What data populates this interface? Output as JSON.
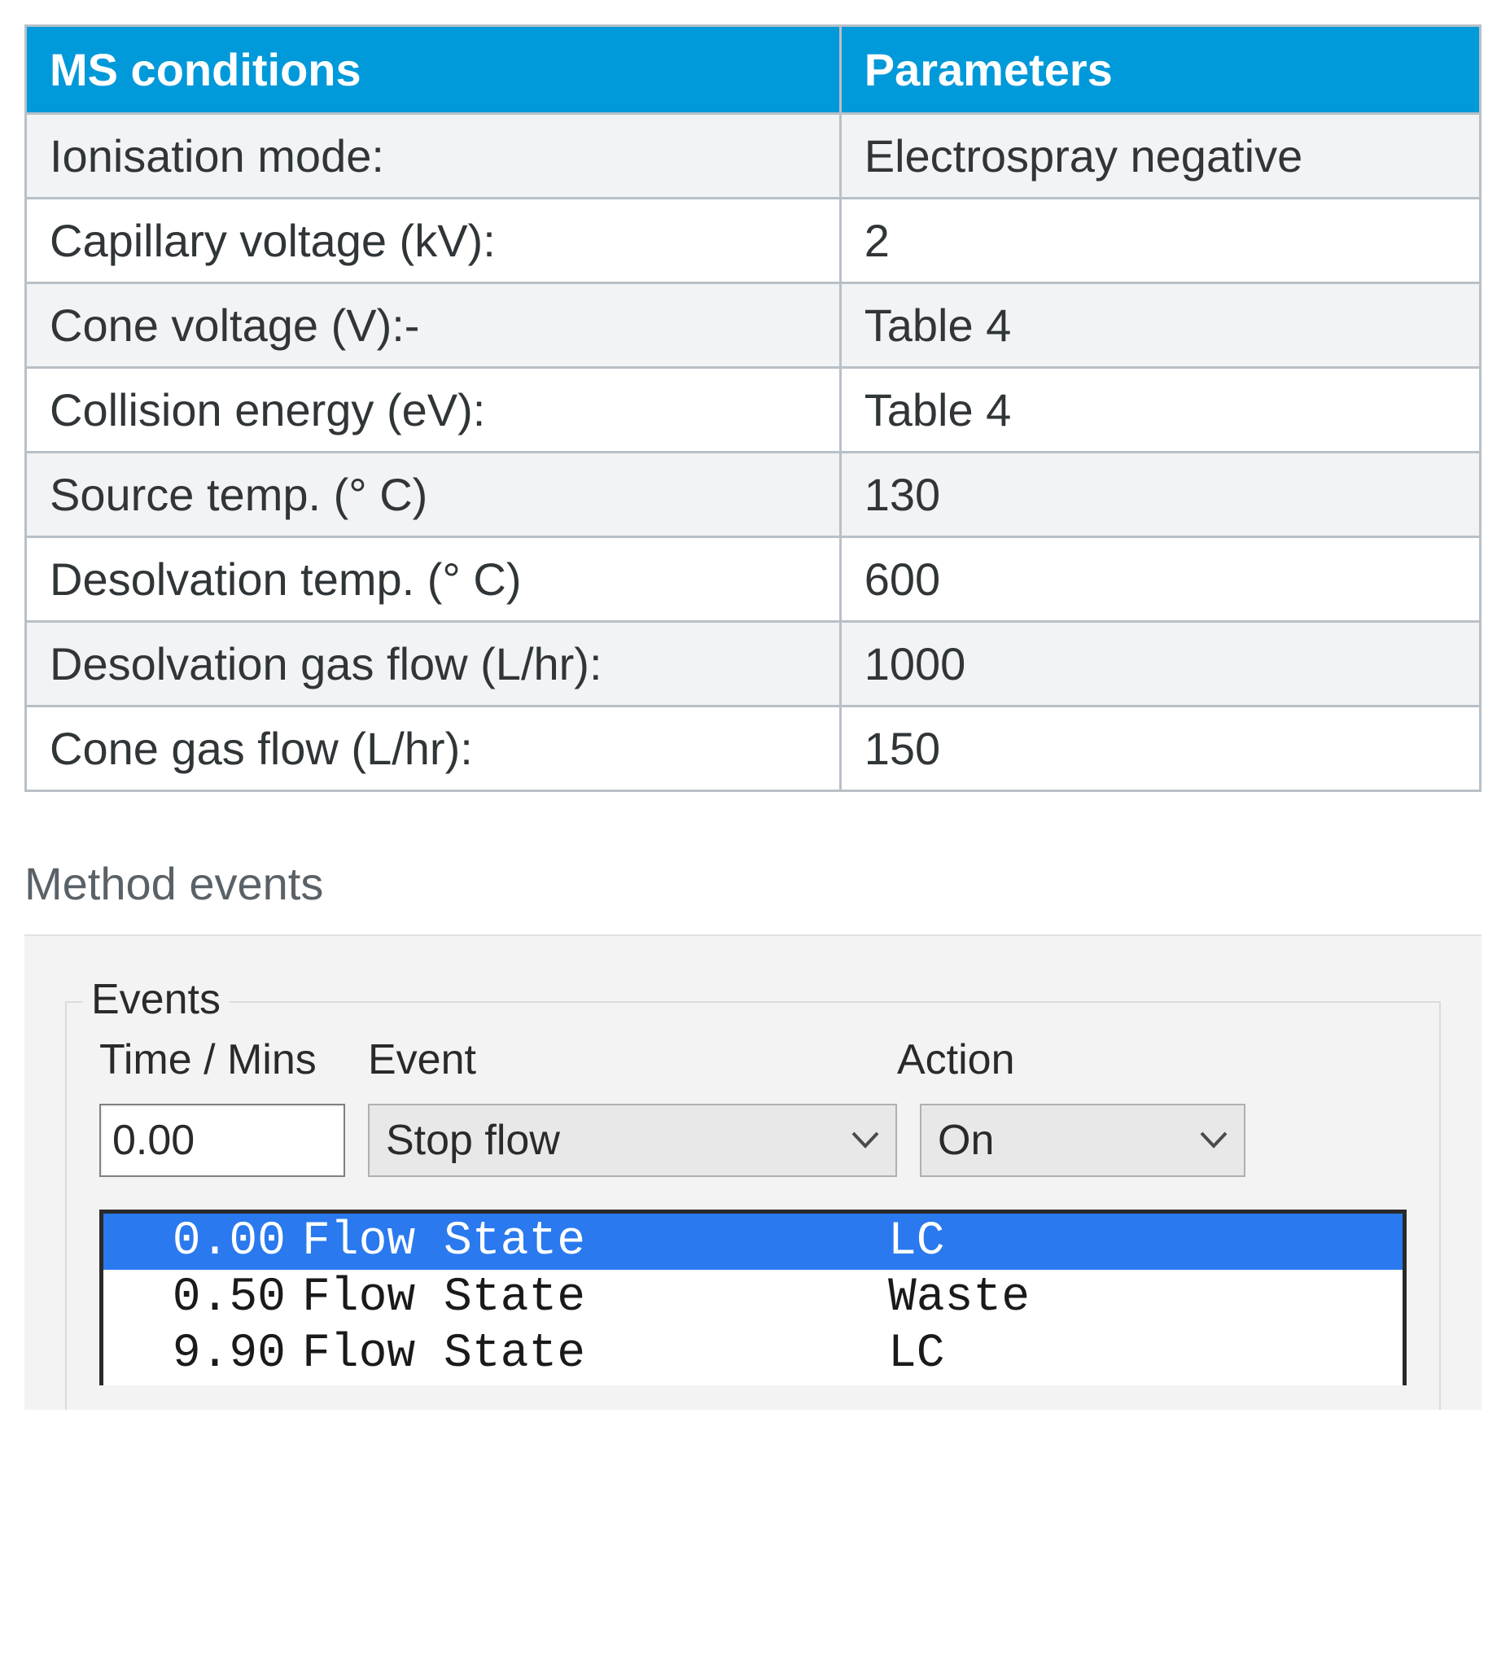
{
  "ms_table": {
    "header": {
      "left": "MS conditions",
      "right": "Parameters"
    },
    "rows": [
      {
        "label": "Ionisation mode:",
        "value": "Electrospray negative"
      },
      {
        "label": "Capillary voltage (kV):",
        "value": "2"
      },
      {
        "label": "Cone voltage (V):-",
        "value": "Table 4"
      },
      {
        "label": "Collision energy (eV):",
        "value": "Table 4"
      },
      {
        "label": "Source temp. (° C)",
        "value": "130"
      },
      {
        "label": "Desolvation temp. (° C)",
        "value": "600"
      },
      {
        "label": "Desolvation gas flow (L/hr):",
        "value": "1000"
      },
      {
        "label": "Cone gas flow (L/hr):",
        "value": "150"
      }
    ]
  },
  "method_events": {
    "title": "Method events",
    "groupbox_legend": "Events",
    "headers": {
      "time": "Time / Mins",
      "event": "Event",
      "action": "Action"
    },
    "inputs": {
      "time_value": "0.00",
      "event_selected": "Stop flow",
      "action_selected": "On"
    },
    "list": [
      {
        "time": "0.00",
        "event": "Flow State",
        "action": "LC",
        "selected": true
      },
      {
        "time": "0.50",
        "event": "Flow State",
        "action": "Waste",
        "selected": false
      },
      {
        "time": "9.90",
        "event": "Flow State",
        "action": "LC",
        "selected": false
      }
    ]
  }
}
